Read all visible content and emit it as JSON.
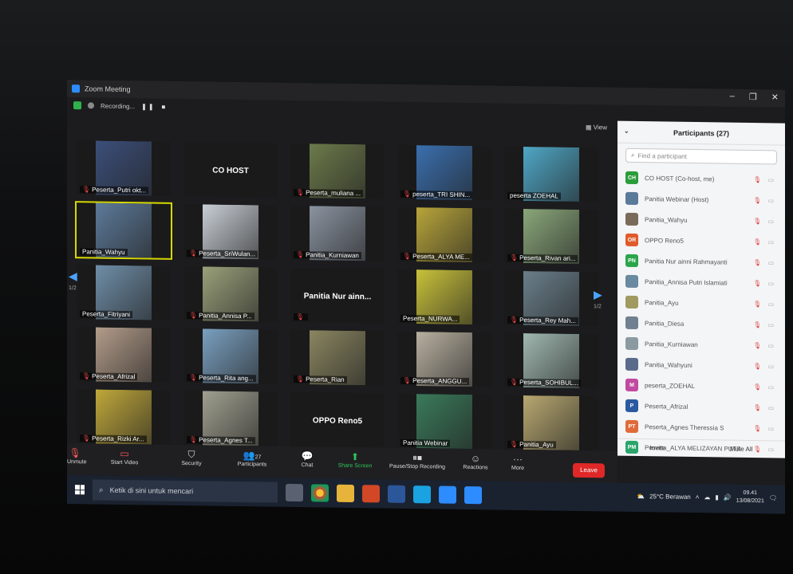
{
  "window": {
    "title": "Zoom Meeting",
    "controls": [
      "–",
      "❐",
      "✕"
    ]
  },
  "recording": {
    "label": "Recording...",
    "pause": "❚❚",
    "stop": "■"
  },
  "view_label": "View",
  "tiles": [
    {
      "name": "Peserta_Putri okt...",
      "muted": true,
      "color": "#3b4f7a"
    },
    {
      "name": "",
      "muted": false,
      "big": "CO HOST",
      "color": "#1a1a1a"
    },
    {
      "name": "Peserta_muliana ...",
      "muted": true,
      "color": "#6c7a4a"
    },
    {
      "name": "peserta_TRI SHIN...",
      "muted": true,
      "color": "#3a6fae"
    },
    {
      "name": "peserta ZOEHAL",
      "muted": false,
      "color": "#4fa7c6"
    },
    {
      "name": "Panitia_Wahyu",
      "muted": false,
      "color": "#5d7a9a"
    },
    {
      "name": "Peserta_SriWulan...",
      "muted": true,
      "color": "#c9cfd6"
    },
    {
      "name": "Panitia_Kurniawan",
      "muted": true,
      "color": "#8a93a0"
    },
    {
      "name": "Peserta_ALYA ME...",
      "muted": true,
      "color": "#b8a53a"
    },
    {
      "name": "Peserta_Rivan ari...",
      "muted": true,
      "color": "#8aa77a"
    },
    {
      "name": "Peserta_Fitriyani",
      "muted": false,
      "color": "#6f8ea8"
    },
    {
      "name": "Panitia_Annisa P...",
      "muted": true,
      "color": "#9aa07a"
    },
    {
      "name": "",
      "muted": true,
      "big": "Panitia Nur ainn...",
      "color": "#1a1a1a"
    },
    {
      "name": "Peserta_NURWA...",
      "muted": false,
      "color": "#c9c23a"
    },
    {
      "name": "Peserta_Rey Mah...",
      "muted": true,
      "color": "#6a7f8a"
    },
    {
      "name": "Peserta_Afrizal",
      "muted": true,
      "color": "#b39c8a"
    },
    {
      "name": "Peserta_Rita ang...",
      "muted": true,
      "color": "#7aa0c0"
    },
    {
      "name": "Peserta_Rian",
      "muted": true,
      "color": "#8a8560"
    },
    {
      "name": "Peserta_ANGGU...",
      "muted": true,
      "color": "#b8b0a0"
    },
    {
      "name": "Peserta_SOHIBUL...",
      "muted": true,
      "color": "#a0b8b0"
    },
    {
      "name": "Peserta_Rizki Ar...",
      "muted": true,
      "color": "#c0a83a"
    },
    {
      "name": "Peserta_Agnes T...",
      "muted": true,
      "color": "#a0a090"
    },
    {
      "name": "",
      "muted": false,
      "big": "OPPO Reno5",
      "color": "#1a1a1a"
    },
    {
      "name": "Panitia Webinar",
      "muted": false,
      "color": "#3a7a5a"
    },
    {
      "name": "Panitia_Ayu",
      "muted": true,
      "color": "#b8a870"
    }
  ],
  "page_indicator_left": "1/2",
  "page_indicator_right": "1/2",
  "panel": {
    "title": "Participants (27)",
    "search_placeholder": "Find a participant",
    "participants": [
      {
        "initials": "CH",
        "color": "#2a9d3a",
        "name": "CO HOST (Co-host, me)"
      },
      {
        "initials": "",
        "color": "#5a7a9a",
        "name": "Panitia Webinar (Host)"
      },
      {
        "initials": "",
        "color": "#7a6a5a",
        "name": "Panitia_Wahyu"
      },
      {
        "initials": "OR",
        "color": "#e05a2a",
        "name": "OPPO Reno5"
      },
      {
        "initials": "PN",
        "color": "#2aa54a",
        "name": "Panitia Nur ainni Rahmayanti"
      },
      {
        "initials": "",
        "color": "#6a8aa0",
        "name": "Panitia_Annisa Putri Islamiati"
      },
      {
        "initials": "",
        "color": "#a09a60",
        "name": "Panitia_Ayu"
      },
      {
        "initials": "",
        "color": "#708090",
        "name": "Panitia_Diesa"
      },
      {
        "initials": "",
        "color": "#8a9aa0",
        "name": "Panitia_Kurniawan"
      },
      {
        "initials": "",
        "color": "#5a6a8a",
        "name": "Panitia_Wahyuni"
      },
      {
        "initials": "M",
        "color": "#c04aa0",
        "name": "peserta_ZOEHAL"
      },
      {
        "initials": "P",
        "color": "#2a5aa0",
        "name": "Peserta_Afrizal"
      },
      {
        "initials": "PT",
        "color": "#e06a3a",
        "name": "Peserta_Agnes Theressia S"
      },
      {
        "initials": "PM",
        "color": "#2aa56a",
        "name": "Peserta_ALYA MELIZAYAN PUTRI"
      }
    ],
    "invite": "Invite",
    "mute_all": "Mute All"
  },
  "toolbar": {
    "unmute": "Unmute",
    "start_video": "Start Video",
    "security": "Security",
    "participants": "Participants",
    "participants_count": "27",
    "chat": "Chat",
    "share_screen": "Share Screen",
    "pause_recording": "Pause/Stop Recording",
    "reactions": "Reactions",
    "more": "More",
    "leave": "Leave"
  },
  "taskbar": {
    "search_placeholder": "Ketik di sini untuk mencari",
    "weather": "25°C Berawan",
    "time": "09.41",
    "date": "13/08/2021"
  }
}
